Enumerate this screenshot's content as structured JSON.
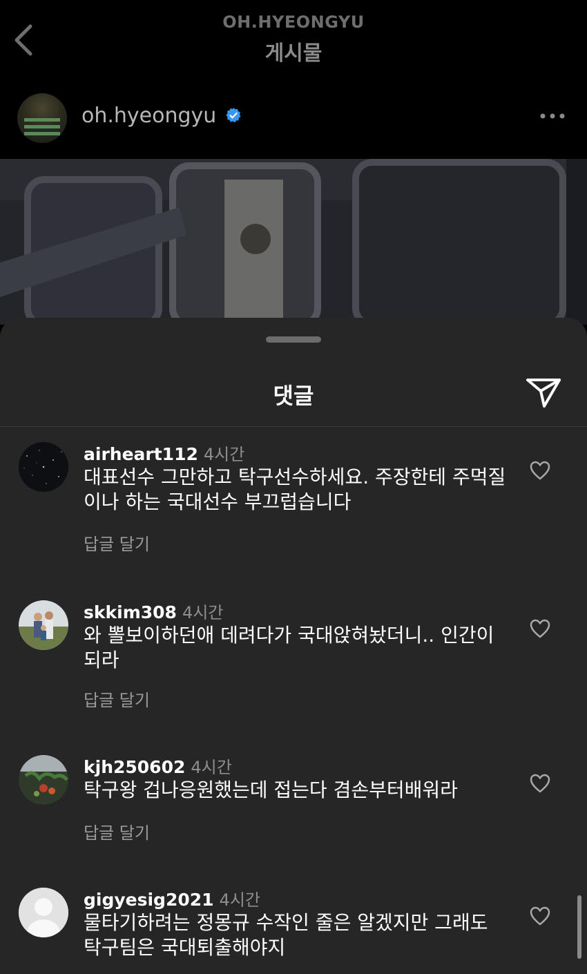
{
  "header": {
    "account_name": "OH.HYEONGYU",
    "title": "게시물"
  },
  "post": {
    "username": "oh.hyeongyu",
    "verified": true,
    "icons": {
      "back": "chevron-left-icon",
      "more": "more-horizontal-icon",
      "verified": "verified-badge-icon"
    }
  },
  "comments_sheet": {
    "title": "댓글",
    "share_icon": "send-icon",
    "comments": [
      {
        "username": "airheart112",
        "time": "4시간",
        "text": "대표선수 그만하고 탁구선수하세요. 주장한테 주먹질이나 하는 국대선수 부끄럽습니다",
        "reply_label": "답글 달기"
      },
      {
        "username": "skkim308",
        "time": "4시간",
        "text": "와 뽈보이하던애 데려다가 국대앉혀놨더니.. 인간이되라",
        "reply_label": "답글 달기"
      },
      {
        "username": "kjh250602",
        "time": "4시간",
        "text": "탁구왕 겁나응원했는데 접는다 겸손부터배워라",
        "reply_label": "답글 달기"
      },
      {
        "username": "gigyesig2021",
        "time": "4시간",
        "text": "물타기하려는 정몽규 수작인 줄은 알겠지만 그래도 탁구팀은 국대퇴출해야지",
        "reply_label": ""
      }
    ]
  },
  "colors": {
    "background": "#000000",
    "sheet": "#262626",
    "secondary_text": "#8e8e8e",
    "verified": "#3897f0"
  }
}
